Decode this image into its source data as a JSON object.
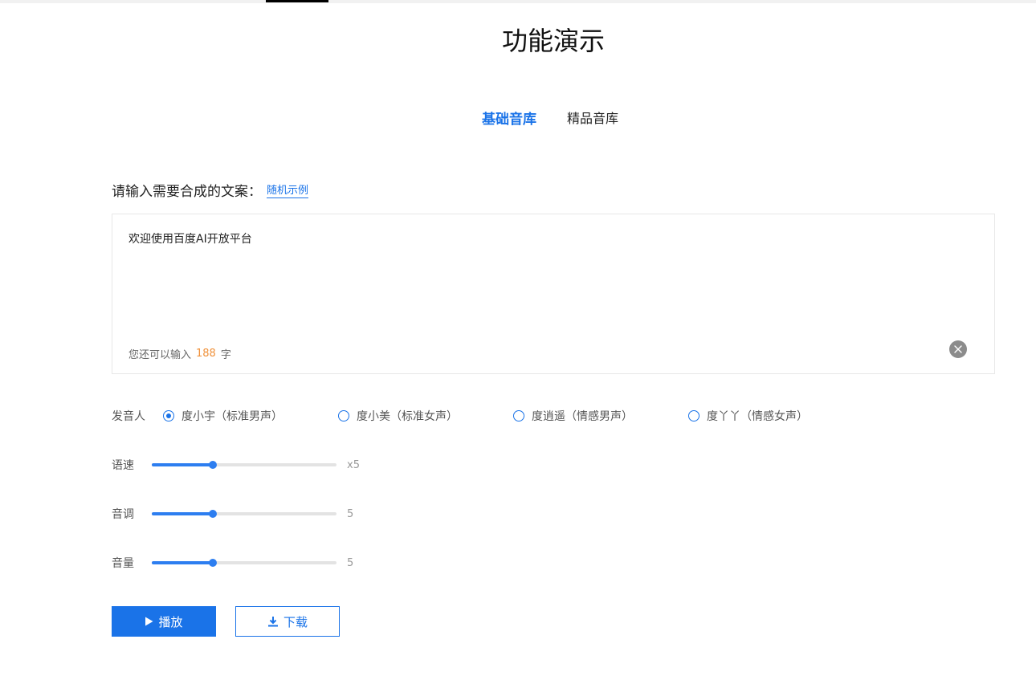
{
  "header": {
    "title": "功能演示"
  },
  "tabs": [
    {
      "label": "基础音库",
      "active": true
    },
    {
      "label": "精品音库",
      "active": false
    }
  ],
  "input": {
    "prompt": "请输入需要合成的文案：",
    "random_link": "随机示例",
    "value": "欢迎使用百度AI开放平台",
    "counter_prefix": "您还可以输入",
    "counter_value": "188",
    "counter_suffix": "字"
  },
  "speaker": {
    "label": "发音人",
    "options": [
      {
        "label": "度小宇（标准男声）",
        "checked": true
      },
      {
        "label": "度小美（标准女声）",
        "checked": false
      },
      {
        "label": "度逍遥（情感男声）",
        "checked": false
      },
      {
        "label": "度丫丫（情感女声）",
        "checked": false
      }
    ]
  },
  "sliders": [
    {
      "label": "语速",
      "value": "x5",
      "level": 0.33
    },
    {
      "label": "音调",
      "value": "5",
      "level": 0.33
    },
    {
      "label": "音量",
      "value": "5",
      "level": 0.33
    }
  ],
  "buttons": {
    "play": "播放",
    "download": "下载"
  },
  "colors": {
    "accent": "#1a73e8",
    "counter": "#f0913a"
  }
}
